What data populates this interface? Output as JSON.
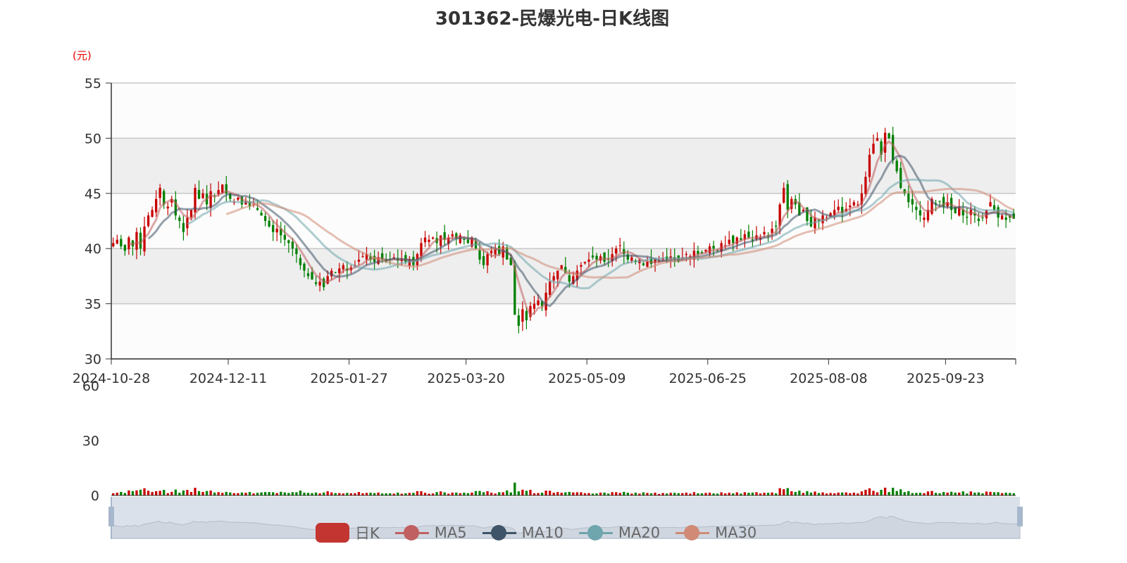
{
  "chart_data": {
    "type": "candlestick",
    "title": "301362-民爆光电-日K线图",
    "ylabel": "(元)",
    "ylim": [
      30,
      55
    ],
    "yticks": [
      30,
      35,
      40,
      45,
      50,
      55
    ],
    "volume_ylim": [
      0,
      60
    ],
    "volume_yticks": [
      0,
      30,
      60
    ],
    "xticks": [
      {
        "index": 0,
        "label": "2024-10-28"
      },
      {
        "index": 30,
        "label": "2024-12-11"
      },
      {
        "index": 61,
        "label": "2025-01-27"
      },
      {
        "index": 91,
        "label": "2025-03-20"
      },
      {
        "index": 122,
        "label": "2025-05-09"
      },
      {
        "index": 153,
        "label": "2025-06-25"
      },
      {
        "index": 184,
        "label": "2025-08-08"
      },
      {
        "index": 214,
        "label": "2025-09-23"
      }
    ],
    "closes": [
      40.5,
      40.8,
      40.2,
      39.8,
      41.0,
      40.2,
      41.5,
      40.0,
      42.0,
      43.0,
      43.5,
      44.5,
      45.5,
      44.0,
      43.8,
      44.5,
      43.0,
      42.5,
      41.5,
      42.8,
      43.5,
      45.5,
      44.5,
      45.0,
      44.0,
      45.2,
      44.8,
      45.3,
      45.8,
      45.0,
      44.5,
      44.2,
      44.6,
      44.0,
      44.3,
      43.8,
      44.0,
      43.5,
      43.0,
      42.5,
      42.0,
      41.5,
      41.8,
      41.2,
      40.8,
      40.5,
      40.0,
      39.5,
      38.5,
      38.0,
      37.5,
      37.2,
      36.8,
      37.0,
      36.5,
      37.5,
      38.0,
      37.8,
      38.2,
      38.5,
      38.0,
      38.3,
      38.5,
      39.0,
      39.3,
      39.5,
      39.0,
      38.8,
      39.2,
      39.0,
      38.8,
      39.0,
      39.2,
      38.9,
      39.1,
      38.8,
      39.0,
      38.5,
      39.5,
      40.5,
      41.0,
      40.8,
      41.0,
      40.5,
      41.2,
      40.8,
      41.0,
      41.3,
      40.9,
      41.2,
      40.8,
      40.5,
      41.0,
      40.0,
      39.0,
      38.5,
      39.5,
      39.8,
      40.0,
      39.5,
      40.2,
      39.0,
      38.5,
      34.0,
      33.0,
      34.5,
      33.5,
      34.8,
      35.0,
      35.3,
      34.8,
      36.0,
      37.0,
      37.5,
      38.0,
      38.5,
      37.8,
      37.0,
      37.5,
      38.0,
      38.5,
      38.8,
      39.0,
      39.2,
      39.0,
      39.3,
      38.8,
      39.0,
      39.5,
      40.0,
      40.3,
      39.5,
      39.0,
      39.2,
      38.8,
      39.0,
      38.5,
      38.8,
      38.6,
      39.0,
      38.9,
      39.1,
      39.0,
      39.3,
      39.0,
      38.8,
      39.2,
      39.5,
      39.3,
      39.8,
      39.5,
      39.6,
      39.9,
      40.2,
      40.0,
      39.8,
      40.5,
      40.3,
      40.8,
      40.5,
      41.0,
      40.8,
      41.3,
      41.0,
      40.7,
      41.2,
      41.0,
      41.5,
      41.2,
      41.8,
      42.0,
      44.0,
      45.5,
      43.5,
      44.5,
      44.0,
      43.0,
      43.5,
      42.5,
      42.0,
      42.8,
      42.5,
      43.0,
      42.8,
      43.2,
      43.5,
      43.8,
      43.2,
      43.6,
      43.9,
      44.2,
      44.0,
      45.0,
      46.5,
      48.5,
      49.5,
      50.0,
      48.5,
      50.5,
      50.0,
      48.0,
      47.0,
      45.5,
      45.0,
      44.2,
      44.0,
      43.5,
      43.0,
      42.8,
      43.5,
      44.5,
      44.0,
      44.3,
      43.8,
      44.2,
      43.5,
      43.2,
      43.8,
      43.0,
      42.8,
      43.5,
      43.0,
      42.5,
      42.8,
      43.5,
      44.2,
      43.5,
      42.8,
      43.0,
      42.6,
      42.8,
      42.7
    ],
    "series": [
      {
        "name": "日K",
        "color": "#c23531"
      },
      {
        "name": "MA5",
        "period": 5,
        "color": "#c06060"
      },
      {
        "name": "MA10",
        "period": 10,
        "color": "#3f5468"
      },
      {
        "name": "MA20",
        "period": 20,
        "color": "#6fa5ad"
      },
      {
        "name": "MA30",
        "period": 30,
        "color": "#d08a75"
      }
    ],
    "up_color": "#c80000",
    "down_color": "#008000"
  }
}
